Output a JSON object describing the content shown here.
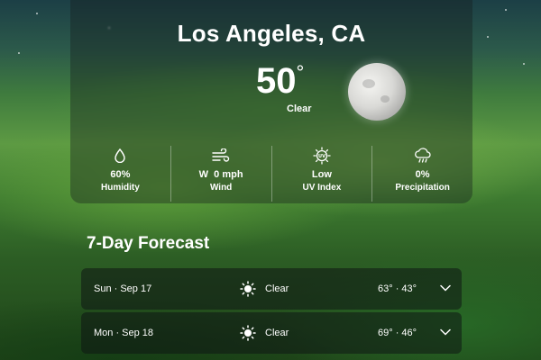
{
  "location": {
    "city": "Los Angeles, CA"
  },
  "current": {
    "temperature": "50",
    "degree_symbol": "°",
    "condition": "Clear",
    "icon": "moon-icon"
  },
  "stats": [
    {
      "value": "60%",
      "label": "Humidity",
      "icon": "humidity-drop-icon"
    },
    {
      "value": "W  0 mph",
      "label": "Wind",
      "icon": "wind-icon"
    },
    {
      "value": "Low",
      "label": "UV Index",
      "icon": "uv-index-icon"
    },
    {
      "value": "0%",
      "label": "Precipitation",
      "icon": "rain-cloud-icon"
    }
  ],
  "forecast": {
    "title": "7-Day Forecast",
    "days": [
      {
        "day": "Sun · Sep 17",
        "condition": "Clear",
        "range": "63° · 43°",
        "icon": "sun-icon"
      },
      {
        "day": "Mon · Sep 18",
        "condition": "Clear",
        "range": "69° · 46°",
        "icon": "sun-icon"
      }
    ]
  },
  "colors": {
    "text": "#ffffff",
    "panel": "rgba(20,30,30,.38)",
    "row": "rgba(15,22,20,.55)"
  }
}
